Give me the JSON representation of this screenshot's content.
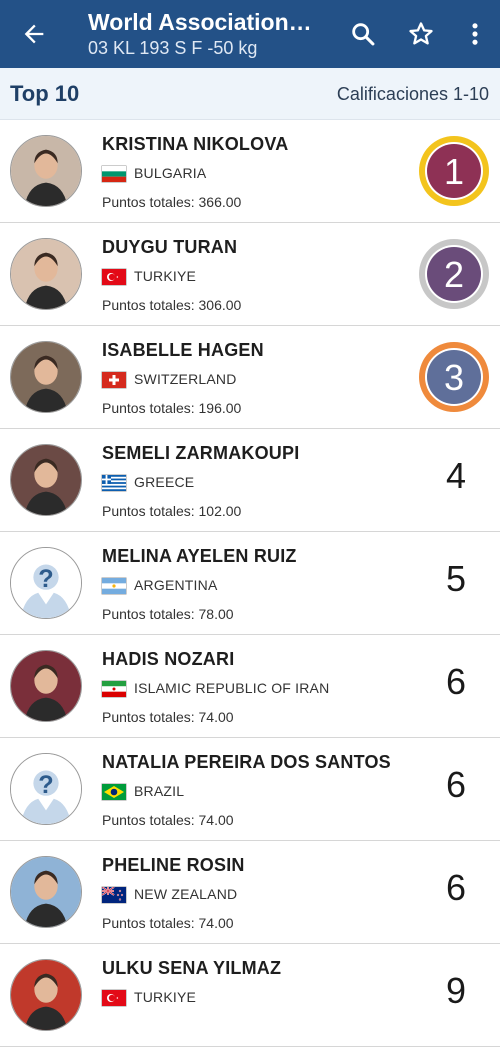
{
  "appbar": {
    "title": "World Association…",
    "subtitle": "03 KL 193 S F -50 kg",
    "icons": [
      "back-arrow-icon",
      "search-icon",
      "star-outline-icon",
      "more-vert-icon"
    ]
  },
  "subheader": {
    "left": "Top 10",
    "right": "Calificaciones 1-10"
  },
  "colors": {
    "appbar": "#235187",
    "subheader_bg": "#eef4fa",
    "gold": "#f3c41d",
    "silver": "#c7c7c7",
    "bronze": "#ef8a3c",
    "medal_inner": "#8f3a5f"
  },
  "rows": [
    {
      "name": "KRISTINA NIKOLOVA",
      "country": "BULGARIA",
      "flag": "bg",
      "points": "Puntos totales: 366.00",
      "rank": "1",
      "medal": "gold",
      "avatar": "photo"
    },
    {
      "name": "DUYGU TURAN",
      "country": "TURKIYE",
      "flag": "tr",
      "points": "Puntos totales: 306.00",
      "rank": "2",
      "medal": "silver",
      "avatar": "photo"
    },
    {
      "name": "ISABELLE HAGEN",
      "country": "SWITZERLAND",
      "flag": "ch",
      "points": "Puntos totales: 196.00",
      "rank": "3",
      "medal": "bronze",
      "avatar": "photo"
    },
    {
      "name": "SEMELI ZARMAKOUPI",
      "country": "GREECE",
      "flag": "gr",
      "points": "Puntos totales: 102.00",
      "rank": "4",
      "medal": "",
      "avatar": "photo"
    },
    {
      "name": "MELINA AYELEN RUIZ",
      "country": "ARGENTINA",
      "flag": "ar",
      "points": "Puntos totales: 78.00",
      "rank": "5",
      "medal": "",
      "avatar": "placeholder"
    },
    {
      "name": "HADIS NOZARI",
      "country": "ISLAMIC REPUBLIC OF IRAN",
      "flag": "ir",
      "points": "Puntos totales: 74.00",
      "rank": "6",
      "medal": "",
      "avatar": "photo"
    },
    {
      "name": "NATALIA PEREIRA DOS SANTOS",
      "country": "BRAZIL",
      "flag": "br",
      "points": "Puntos totales: 74.00",
      "rank": "6",
      "medal": "",
      "avatar": "placeholder"
    },
    {
      "name": "PHELINE ROSIN",
      "country": "NEW ZEALAND",
      "flag": "nz",
      "points": "Puntos totales: 74.00",
      "rank": "6",
      "medal": "",
      "avatar": "photo"
    },
    {
      "name": "ULKU SENA YILMAZ",
      "country": "TURKIYE",
      "flag": "tr",
      "points": "",
      "rank": "9",
      "medal": "",
      "avatar": "photo"
    }
  ]
}
